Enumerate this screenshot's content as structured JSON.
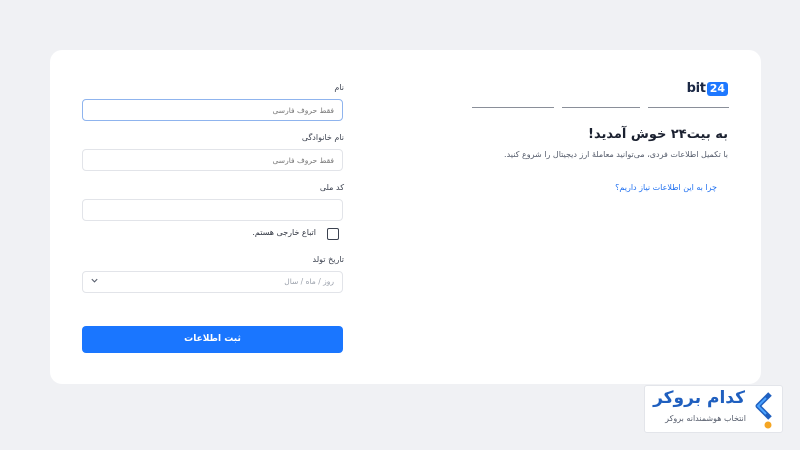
{
  "welcome": {
    "logo_text": "bit",
    "logo_number": "24",
    "title": "به بیت۲۴ خوش آمدید!",
    "subtitle": "با تکمیل اطلاعات فردی، می‌توانید معاملهٔ ارز دیجیتال را شروع کنید.",
    "why_link": "چرا به این اطلاعات نیاز داریم؟",
    "steps_count": 3
  },
  "form": {
    "first_name": {
      "label": "نام",
      "placeholder": "فقط حروف فارسی",
      "value": ""
    },
    "last_name": {
      "label": "نام خانوادگی",
      "placeholder": "فقط حروف فارسی",
      "value": ""
    },
    "national_code": {
      "label": "کد ملی",
      "placeholder": "",
      "value": ""
    },
    "foreign_checkbox": {
      "label": "اتباع خارجی هستم.",
      "checked": false
    },
    "birth_date": {
      "label": "تاریخ تولد",
      "placeholder": "روز / ماه / سال"
    },
    "submit_label": "ثبت اطلاعات"
  },
  "watermark": {
    "title": "کدام بروکر",
    "subtitle": "انتخاب هوشمندانه بروکر"
  },
  "colors": {
    "accent": "#1a76ff",
    "background": "#f0f1f4",
    "link": "#1e6ff0"
  }
}
